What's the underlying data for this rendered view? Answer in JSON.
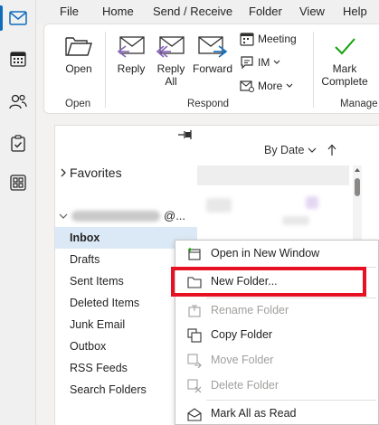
{
  "menubar": {
    "tabs": [
      "File",
      "Home",
      "Send / Receive",
      "Folder",
      "View",
      "Help"
    ]
  },
  "rail": {
    "items": [
      "mail-icon",
      "calendar-icon",
      "people-icon",
      "tasks-icon",
      "apps-icon"
    ]
  },
  "ribbon": {
    "open_label": "Open",
    "open_group": "Open",
    "reply_label": "Reply",
    "reply_all_label": "Reply\nAll",
    "forward_label": "Forward",
    "meeting_label": "Meeting",
    "im_label": "IM",
    "more_label": "More",
    "respond_group": "Respond",
    "mark_complete_label": "Mark\nComplete",
    "manage_group": "Manage",
    "colors": {
      "accent": "#0f6cbd",
      "reply_purple": "#8764b8",
      "check_green": "#13a10e"
    }
  },
  "folder_pane": {
    "favorites_label": "Favorites",
    "account_suffix": "@...",
    "folders": [
      "Inbox",
      "Drafts",
      "Sent Items",
      "Deleted Items",
      "Junk Email",
      "Outbox",
      "RSS Feeds",
      "Search Folders"
    ],
    "selected": "Inbox"
  },
  "message_list": {
    "sort_label": "By Date"
  },
  "context_menu": {
    "items": [
      {
        "label": "Open in New Window",
        "disabled": false
      },
      {
        "label": "New Folder...",
        "disabled": false
      },
      {
        "label": "Rename Folder",
        "disabled": true
      },
      {
        "label": "Copy Folder",
        "disabled": false
      },
      {
        "label": "Move Folder",
        "disabled": true
      },
      {
        "label": "Delete Folder",
        "disabled": true
      },
      {
        "label": "Mark All as Read",
        "disabled": false
      }
    ],
    "highlight_color": "#e81123"
  }
}
